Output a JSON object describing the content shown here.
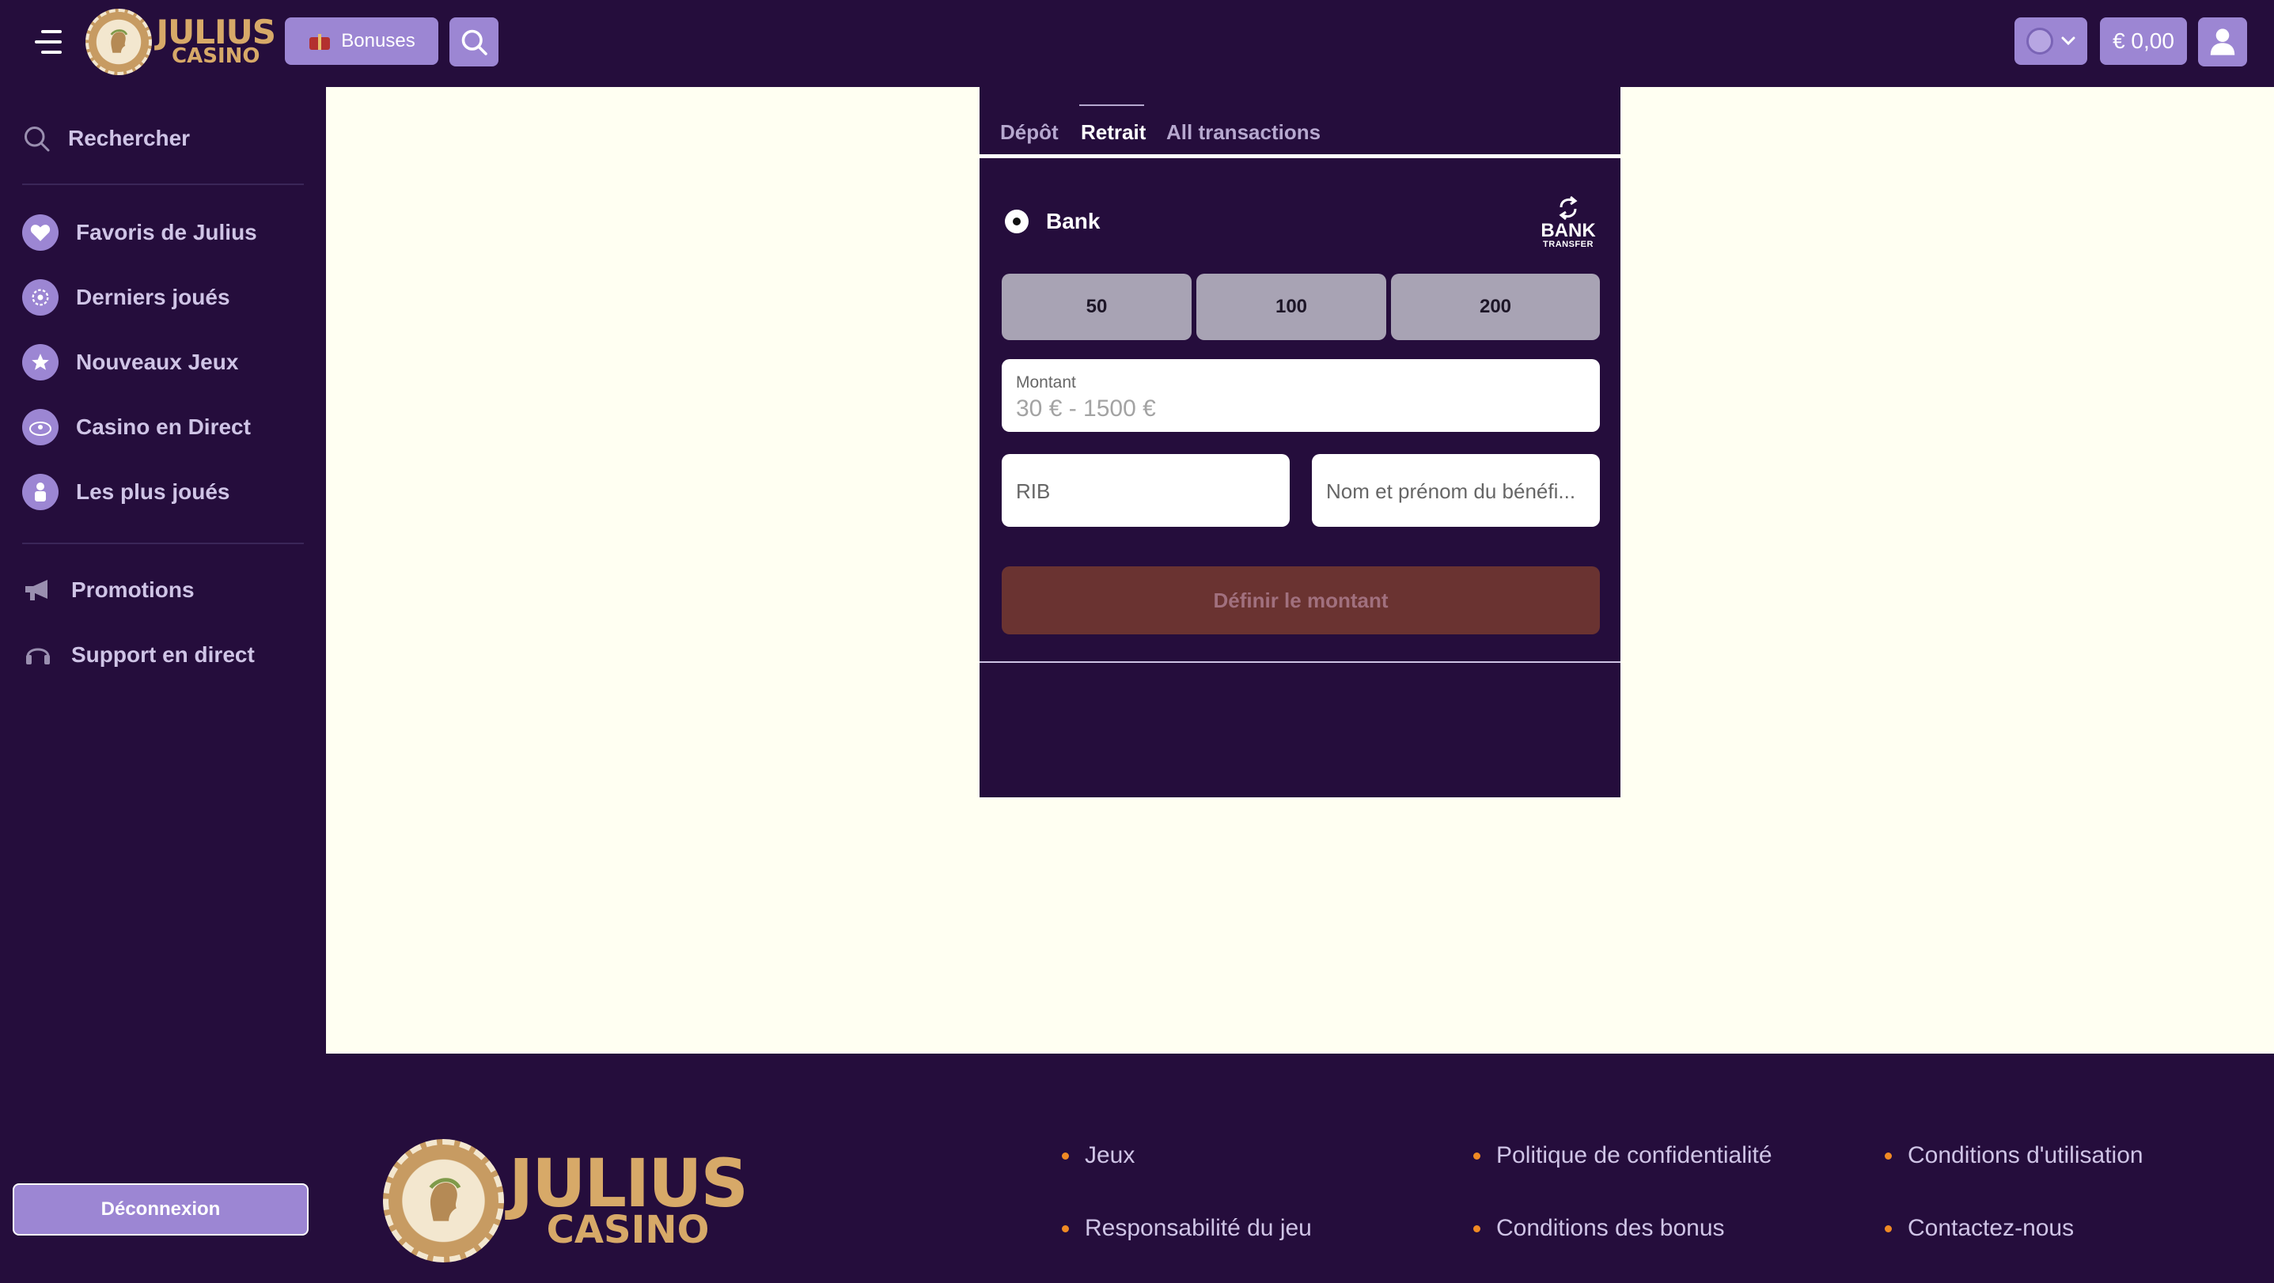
{
  "header": {
    "logo": {
      "line1": "JULIUS",
      "line2": "CASINO"
    },
    "bonuses_label": "Bonuses",
    "balance": "€ 0,00"
  },
  "sidebar": {
    "search_label": "Rechercher",
    "items": [
      {
        "label": "Favoris de Julius",
        "icon": "heart-icon"
      },
      {
        "label": "Derniers joués",
        "icon": "recent-icon"
      },
      {
        "label": "Nouveaux Jeux",
        "icon": "star-icon"
      },
      {
        "label": "Casino en Direct",
        "icon": "live-casino-icon"
      },
      {
        "label": "Les plus joués",
        "icon": "popular-icon"
      }
    ],
    "links": [
      {
        "label": "Promotions",
        "icon": "megaphone-icon"
      },
      {
        "label": "Support en direct",
        "icon": "headset-icon"
      }
    ],
    "logout_label": "Déconnexion"
  },
  "cashier": {
    "tabs": [
      {
        "label": "Dépôt",
        "active": false
      },
      {
        "label": "Retrait",
        "active": true
      },
      {
        "label": "All transactions",
        "active": false
      }
    ],
    "method": {
      "label": "Bank",
      "logo_line1": "BANK",
      "logo_line2": "TRANSFER"
    },
    "amounts": [
      "50",
      "100",
      "200"
    ],
    "montant": {
      "label": "Montant",
      "placeholder": "30 € - 1500 €"
    },
    "rib_placeholder": "RIB",
    "nom_placeholder": "Nom et prénom du bénéfi...",
    "submit_label": "Définir le montant"
  },
  "footer": {
    "logo": {
      "line1": "JULIUS",
      "line2": "CASINO"
    },
    "links": [
      "Jeux",
      "Politique de confidentialité",
      "Conditions d'utilisation",
      "Responsabilité du jeu",
      "Conditions des bonus",
      "Contactez-nous"
    ]
  },
  "colors": {
    "background": "#250d3c",
    "accent": "#9c86d3",
    "content_bg": "#fffff2",
    "gold": "#d7a968",
    "submit_disabled": "#6a3331",
    "footer_bullet": "#f08a24"
  }
}
